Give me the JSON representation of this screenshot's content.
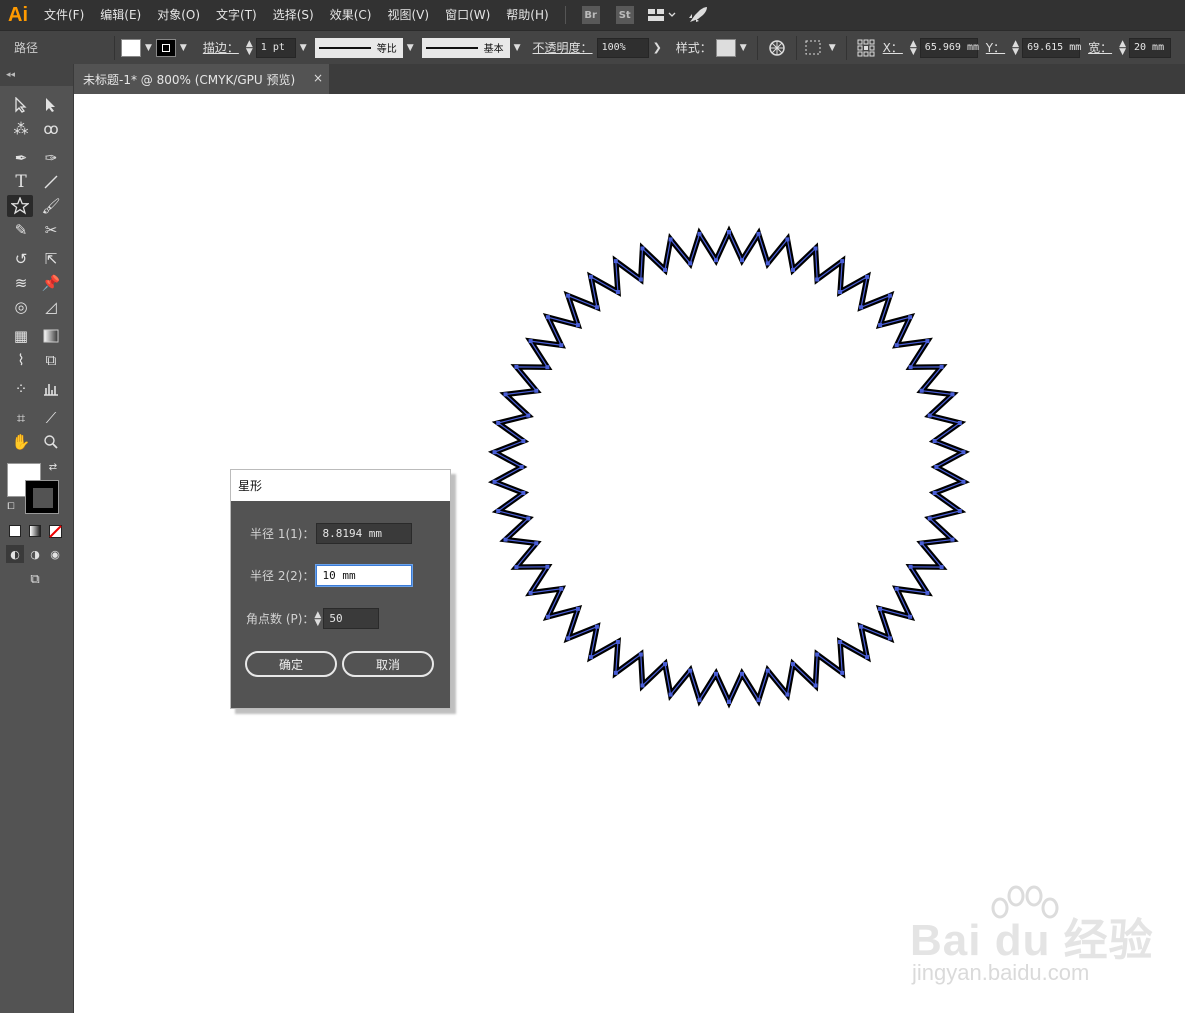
{
  "app": {
    "logo": "Ai"
  },
  "menu": [
    {
      "id": "file",
      "label": "文件(F)"
    },
    {
      "id": "edit",
      "label": "编辑(E)"
    },
    {
      "id": "object",
      "label": "对象(O)"
    },
    {
      "id": "text",
      "label": "文字(T)"
    },
    {
      "id": "select",
      "label": "选择(S)"
    },
    {
      "id": "effect",
      "label": "效果(C)"
    },
    {
      "id": "view",
      "label": "视图(V)"
    },
    {
      "id": "window",
      "label": "窗口(W)"
    },
    {
      "id": "help",
      "label": "帮助(H)"
    }
  ],
  "menu_ext": {
    "bridge": "Br",
    "stock": "St"
  },
  "control": {
    "selection_type": "路径",
    "stroke_label": "描边：",
    "stroke_weight": "1 pt",
    "profile_label": "等比",
    "brush_label": "基本",
    "opacity_label": "不透明度：",
    "opacity_value": "100%",
    "style_label": "样式：",
    "x_label": "X：",
    "x_value": "65.969 mm",
    "y_label": "Y：",
    "y_value": "69.615 mm",
    "w_label": "宽：",
    "w_value": "20 mm"
  },
  "document": {
    "tab_title": "未标题-1* @ 800% (CMYK/GPU 预览)",
    "close": "×"
  },
  "dialog": {
    "title": "星形",
    "radius1_label": "半径 1(1)：",
    "radius1_value": "8.8194 mm",
    "radius2_label": "半径 2(2)：",
    "radius2_value": "10 mm",
    "points_label": "角点数 (P)：",
    "points_value": "50",
    "ok_label": "确定",
    "cancel_label": "取消"
  },
  "star_shape": {
    "points": 50,
    "inner_radius_mm": 8.8194,
    "outer_radius_mm": 10,
    "stroke_color": "#000000",
    "anchor_color": "#4a5fd8"
  },
  "colors": {
    "accent": "#ff9a00",
    "selection": "#4a5fd8"
  },
  "watermark": {
    "main": "Bai du 经验",
    "sub": "jingyan.baidu.com"
  }
}
